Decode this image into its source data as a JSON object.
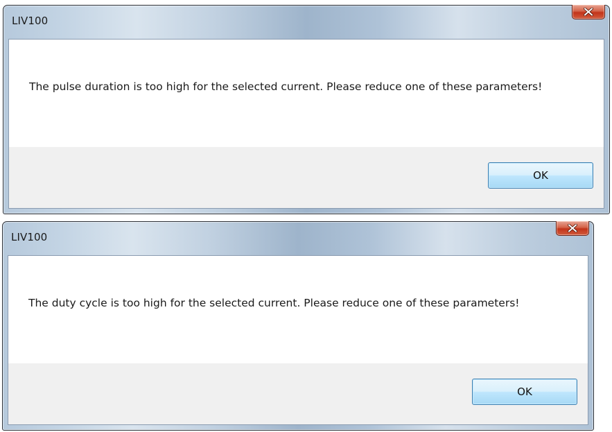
{
  "dialogs": [
    {
      "title": "LIV100",
      "message": "The pulse duration is too high for the selected current. Please reduce one of these parameters!",
      "ok_label": "OK",
      "close_icon": "close-icon"
    },
    {
      "title": "LIV100",
      "message": "The duty cycle is too high for the selected current. Please reduce one of these parameters!",
      "ok_label": "OK",
      "close_icon": "close-icon"
    }
  ],
  "colors": {
    "close_button": "#c2341a",
    "ok_button_border": "#3c7fb1",
    "footer_background": "#f0f0f0"
  }
}
